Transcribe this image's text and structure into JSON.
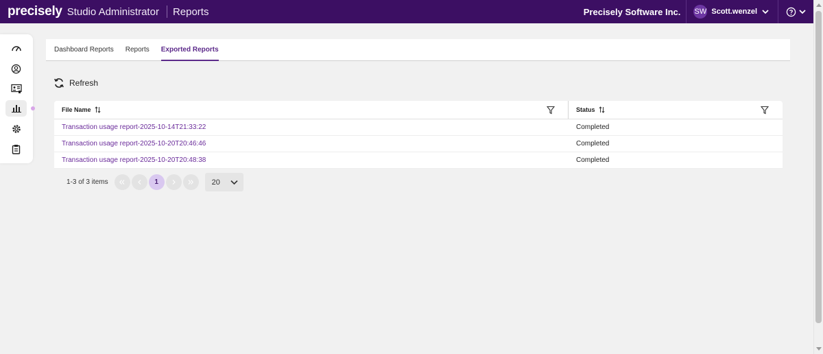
{
  "header": {
    "logo": "precisely",
    "app_title": "Studio Administrator",
    "page_title": "Reports",
    "org_name": "Precisely Software Inc.",
    "user_initials": "SW",
    "user_name": "Scott.wenzel",
    "bg_color": "#3c0f63"
  },
  "nav": {
    "items": [
      {
        "icon": "gauge-icon"
      },
      {
        "icon": "user-circle-icon"
      },
      {
        "icon": "id-card-icon"
      },
      {
        "icon": "bar-chart-icon",
        "active": true
      },
      {
        "icon": "settings-cog-icon"
      },
      {
        "icon": "clipboard-icon"
      }
    ]
  },
  "tabs": [
    {
      "label": "Dashboard Reports"
    },
    {
      "label": "Reports"
    },
    {
      "label": "Exported Reports",
      "active": true
    }
  ],
  "refresh_label": "Refresh",
  "table": {
    "columns": [
      "File Name",
      "Status"
    ],
    "rows": [
      {
        "file": "Transaction usage report-2025-10-14T21:33:22",
        "status": "Completed"
      },
      {
        "file": "Transaction usage report-2025-10-20T20:46:46",
        "status": "Completed"
      },
      {
        "file": "Transaction usage report-2025-10-20T20:48:38",
        "status": "Completed"
      }
    ]
  },
  "pager": {
    "info": "1-3 of 3 items",
    "current_page": "1",
    "page_size": "20"
  },
  "colors": {
    "accent": "#5c2a8a",
    "link": "#6a2b9a"
  }
}
